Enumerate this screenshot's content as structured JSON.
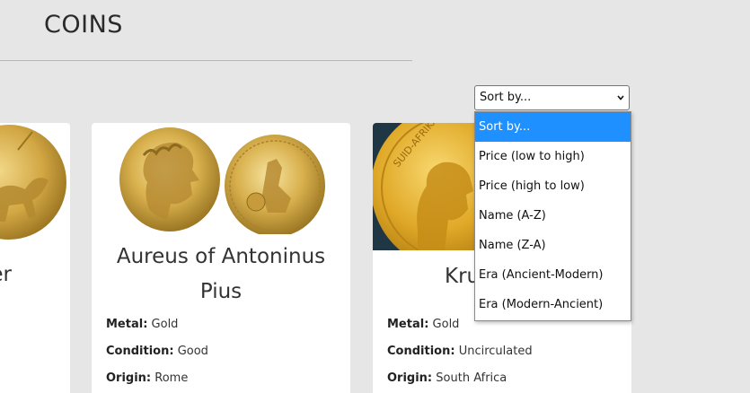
{
  "header": {
    "title": "COINS"
  },
  "sort": {
    "current": "Sort by...",
    "options": [
      "Sort by...",
      "Price (low to high)",
      "Price (high to low)",
      "Name (A-Z)",
      "Name (Z-A)",
      "Era (Ancient-Modern)",
      "Era (Modern-Ancient)"
    ]
  },
  "cards": [
    {
      "name_partial": "er"
    },
    {
      "name": "Aureus of Antoninus Pius",
      "metal_label": "Metal:",
      "metal": "Gold",
      "condition_label": "Condition:",
      "condition": "Good",
      "origin_label": "Origin:",
      "origin": "Rome"
    },
    {
      "name_partial": "Kru",
      "metal_label": "Metal:",
      "metal": "Gold",
      "condition_label": "Condition:",
      "condition": "Uncirculated",
      "origin_label": "Origin:",
      "origin": "South Africa"
    }
  ]
}
